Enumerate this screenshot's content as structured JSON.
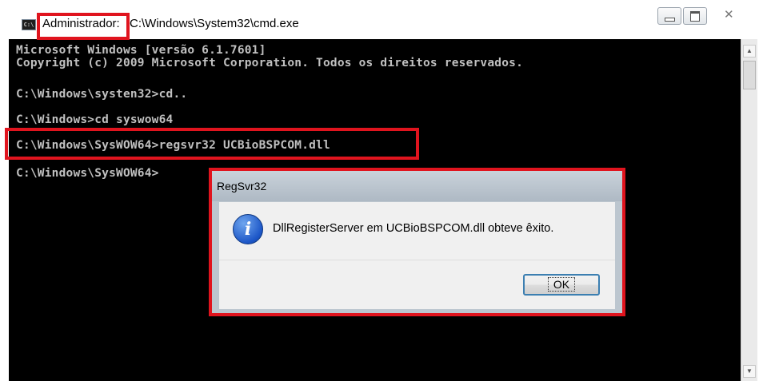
{
  "window": {
    "icon_text": "C:\\",
    "title_prefix": "Administrador:",
    "title_path": "C:\\Windows\\System32\\cmd.exe",
    "controls": {
      "minimize": "minimize",
      "maximize": "maximize",
      "close": "✕"
    }
  },
  "console": {
    "lines": [
      "Microsoft Windows [versão 6.1.7601]",
      "Copyright (c) 2009 Microsoft Corporation. Todos os direitos reservados.",
      "C:\\Windows\\systen32>cd..",
      "C:\\Windows>cd syswow64",
      "C:\\Windows\\SysWOW64>regsvr32 UCBioBSPCOM.dll",
      "C:\\Windows\\SysWOW64>"
    ]
  },
  "dialog": {
    "title": "RegSvr32",
    "icon": "info-icon",
    "icon_glyph": "i",
    "message": "DllRegisterServer em UCBioBSPCOM.dll  obteve êxito.",
    "ok_label": "OK"
  },
  "scrollbar": {
    "up": "▲",
    "down": "▼"
  },
  "colors": {
    "console_bg": "#000000",
    "console_text": "#c0c0c0",
    "highlight": "#e0141e",
    "button_border": "#3c7fb1"
  }
}
